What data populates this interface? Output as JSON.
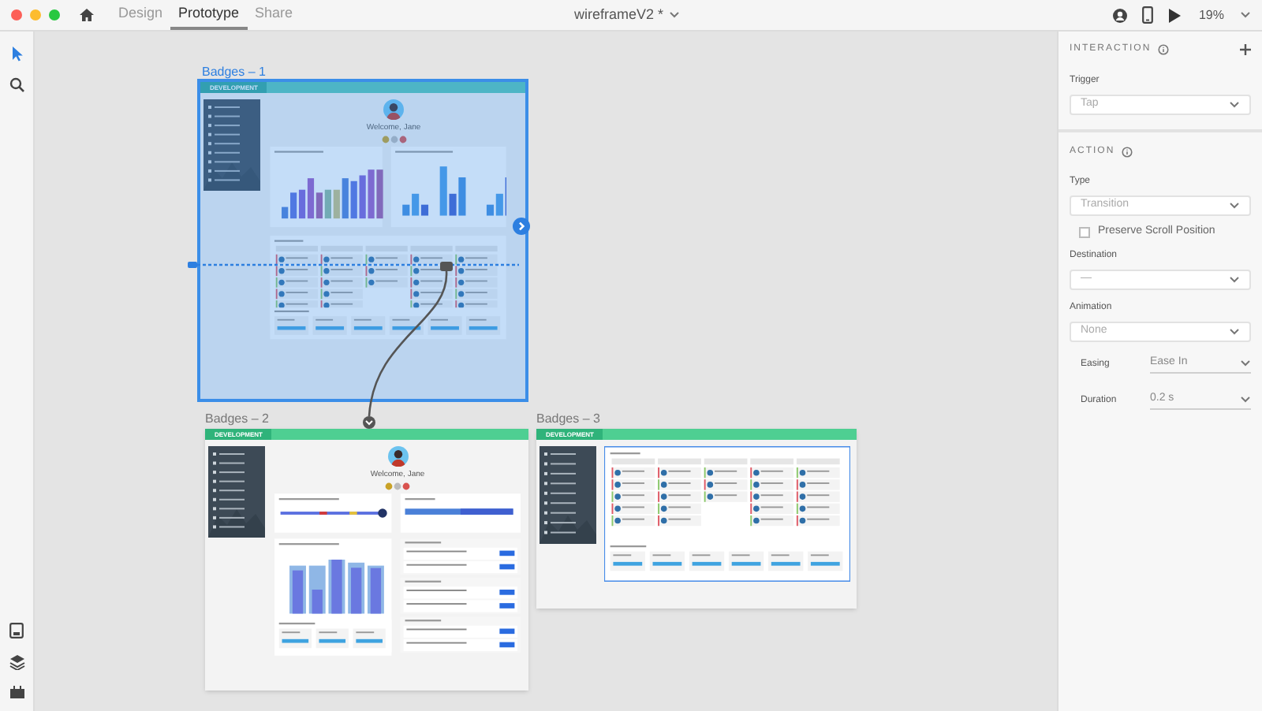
{
  "window": {
    "title": "wireframeV2 *",
    "zoom": "19%"
  },
  "tabs": [
    {
      "label": "Design",
      "selected": false
    },
    {
      "label": "Prototype",
      "selected": true
    },
    {
      "label": "Share",
      "selected": false
    }
  ],
  "artboards": [
    {
      "label": "Badges – 1",
      "selected": true,
      "kind": "dashboard",
      "header": "DEVELOPMENT",
      "welcome": "Welcome, Jane"
    },
    {
      "label": "Badges – 2",
      "selected": false,
      "kind": "overview",
      "header": "DEVELOPMENT",
      "welcome": "Welcome, Jane"
    },
    {
      "label": "Badges – 3",
      "selected": false,
      "kind": "schedule",
      "header": "DEVELOPMENT"
    }
  ],
  "interaction": {
    "title": "INTERACTION",
    "trigger_label": "Trigger",
    "trigger": "Tap"
  },
  "action": {
    "title": "ACTION",
    "type_label": "Type",
    "type": "Transition",
    "preserve_scroll": {
      "label": "Preserve Scroll Position",
      "checked": false
    },
    "destination_label": "Destination",
    "destination": "—",
    "animation_label": "Animation",
    "animation": "None",
    "easing_label": "Easing",
    "easing": "Ease In",
    "duration_label": "Duration",
    "duration": "0.2 s"
  }
}
